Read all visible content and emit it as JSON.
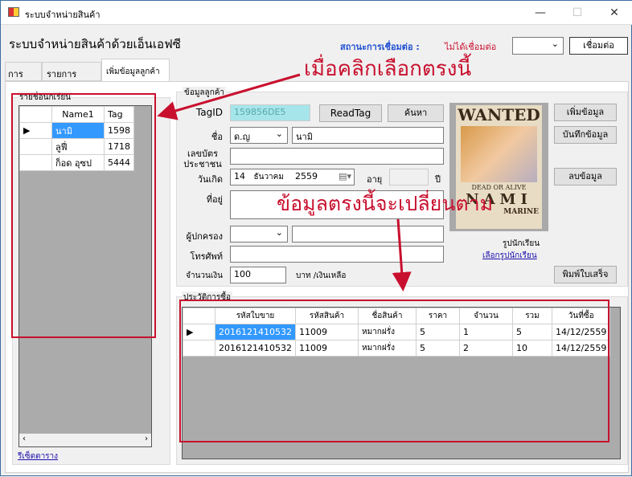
{
  "window": {
    "title": "ระบบจำหน่ายสินค้า",
    "minimize": "—",
    "maximize": "☐",
    "close": "✕"
  },
  "header": {
    "title": "ระบบจำหน่ายสินค้าด้วยเอ็นเอฟซี",
    "status_label": "สถานะการเชื่อมต่อ :",
    "status_value": "ไม่ได้เชื่อมต่อ",
    "port_select": "",
    "connect_button": "เชื่อมต่อ"
  },
  "tabs": [
    {
      "label": "การขาย"
    },
    {
      "label": "รายการสินค้า"
    },
    {
      "label": "เพิ่มข้อมูลลูกค้า"
    }
  ],
  "student_list": {
    "title": "รายชื่อนักเรียน",
    "columns": [
      "Name1",
      "Tag"
    ],
    "rows": [
      [
        "นามิ",
        "1598"
      ],
      [
        "ลูฟี่",
        "1718"
      ],
      [
        "ก็อด อุซป",
        "5444"
      ]
    ],
    "reset_link": "รีเซ็ตตาราง"
  },
  "customer": {
    "title": "ข้อมูลลูกค้า",
    "tagid_label": "TagID",
    "tagid_value": "159856DE5",
    "readtag_button": "ReadTag",
    "search_button": "ค้นหา",
    "name_label": "ชื่อ",
    "prefix_value": "ด.ญ",
    "name_value": "นามิ",
    "idcard_label": "เลขบัตรประชาชน",
    "idcard_value": "",
    "birth_label": "วันเกิด",
    "birth_day": "14",
    "birth_month": "ธันวาคม",
    "birth_year": "2559",
    "age_label": "อายุ",
    "age_value": "",
    "year_unit": "ปี",
    "address_label": "ที่อยู่",
    "address_value": "",
    "guardian_label": "ผู้ปกครอง",
    "guardian_value": "",
    "phone_label": "โทรศัพท์",
    "phone_value": "",
    "money_label": "จำนวนเงิน",
    "money_value": "100",
    "baht_label": "บาท /เงินเหลือ",
    "photo_label": "รูปนักเรียน",
    "photo_link": "เลือกรูปนักเรียน",
    "photo_poster": {
      "wanted": "WANTED",
      "dead": "DEAD OR ALIVE",
      "name": "NAMI",
      "marine": "MARINE"
    },
    "add_button": "เพิ่มข้อมูล",
    "save_button": "บันทึกข้อมูล",
    "delete_button": "ลบข้อมูล",
    "print_button": "พิมพ์ใบเสร็จ"
  },
  "history": {
    "title": "ประวัติการซื้อ",
    "columns": [
      "รหัสใบขาย",
      "รหัสสินค้า",
      "ชื่อสินค้า",
      "ราคา",
      "จำนวน",
      "รวม",
      "วันที่ซื้อ"
    ],
    "rows": [
      [
        "2016121410532",
        "11009",
        "หมากฝรั่ง",
        "5",
        "1",
        "5",
        "14/12/2559"
      ],
      [
        "2016121410532",
        "11009",
        "หมากฝรั่ง",
        "5",
        "2",
        "10",
        "14/12/2559"
      ]
    ]
  },
  "annotations": {
    "click_here": "เมื่อคลิกเลือกตรงนี้",
    "data_changes": "ข้อมูลตรงนี้จะเปลี่ยนตาม"
  },
  "colors": {
    "accent_red": "#c8102e",
    "status_blue": "#1f4fd1",
    "selection": "#3399ff"
  }
}
